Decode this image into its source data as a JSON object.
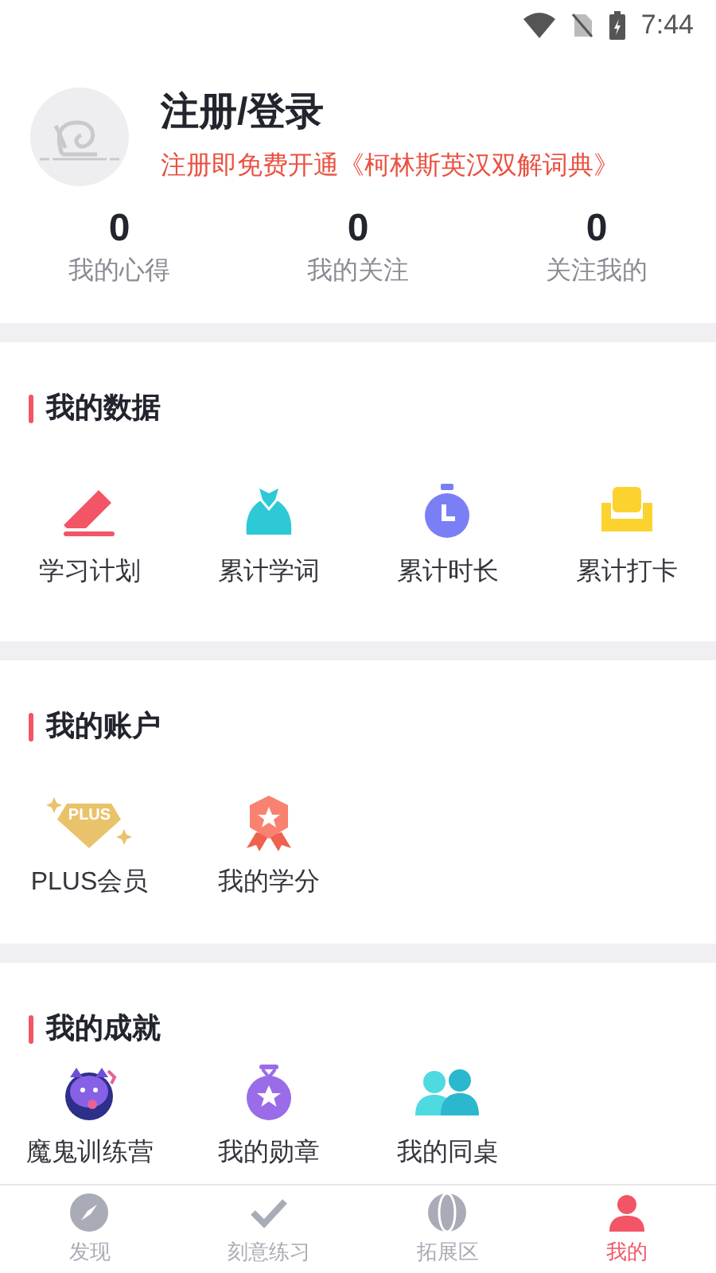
{
  "status_bar": {
    "time": "7:44"
  },
  "profile": {
    "title": "注册/登录",
    "subtitle": "注册即免费开通《柯林斯英汉双解词典》"
  },
  "stats": [
    {
      "value": "0",
      "label": "我的心得"
    },
    {
      "value": "0",
      "label": "我的关注"
    },
    {
      "value": "0",
      "label": "关注我的"
    }
  ],
  "sections": [
    {
      "title": "我的数据",
      "items": [
        {
          "label": "学习计划"
        },
        {
          "label": "累计学词"
        },
        {
          "label": "累计时长"
        },
        {
          "label": "累计打卡"
        }
      ]
    },
    {
      "title": "我的账户",
      "items": [
        {
          "label": "PLUS会员",
          "badge": "PLUS"
        },
        {
          "label": "我的学分"
        }
      ]
    },
    {
      "title": "我的成就",
      "items": [
        {
          "label": "魔鬼训练营"
        },
        {
          "label": "我的勋章"
        },
        {
          "label": "我的同桌"
        }
      ]
    }
  ],
  "bottom_nav": [
    {
      "label": "发现",
      "selected": false
    },
    {
      "label": "刻意练习",
      "selected": false
    },
    {
      "label": "拓展区",
      "selected": false
    },
    {
      "label": "我的",
      "selected": true
    }
  ]
}
